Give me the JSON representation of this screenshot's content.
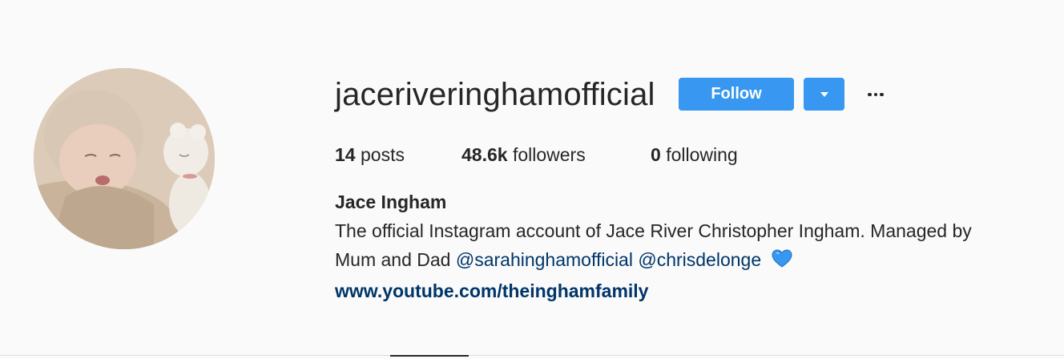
{
  "profile": {
    "username": "jaceriveringhamofficial",
    "follow_label": "Follow",
    "stats": {
      "posts_count": "14",
      "posts_label": "posts",
      "followers_count": "48.6k",
      "followers_label": "followers",
      "following_count": "0",
      "following_label": "following"
    },
    "full_name": "Jace Ingham",
    "bio_line1": "The official Instagram account of Jace River Christopher Ingham. Managed by",
    "bio_line2_prefix": "Mum and Dad",
    "mention1": "@sarahinghamofficial",
    "mention2": "@chrisdelonge",
    "website": "www.youtube.com/theinghamfamily"
  },
  "colors": {
    "accent": "#3897f0",
    "link": "#003569",
    "text": "#262626",
    "background": "#fafafa",
    "heart": "#3897f0"
  },
  "icons": {
    "dropdown": "chevron-down-icon",
    "more": "more-options-icon",
    "heart": "blue-heart-emoji"
  }
}
